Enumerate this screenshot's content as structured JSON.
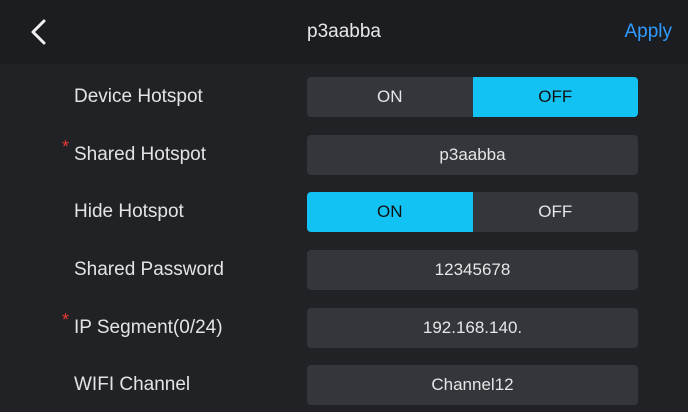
{
  "header": {
    "back_icon": "chevron-left-icon",
    "title": "p3aabba",
    "apply_label": "Apply",
    "apply_color": "#2f9bff"
  },
  "rows": {
    "device_hotspot": {
      "label": "Device Hotspot",
      "on_label": "ON",
      "off_label": "OFF",
      "selected": "OFF"
    },
    "shared_hotspot": {
      "label": "Shared Hotspot",
      "required_mark": "*",
      "value": "p3aabba"
    },
    "hide_hotspot": {
      "label": "Hide Hotspot",
      "on_label": "ON",
      "off_label": "OFF",
      "selected": "ON"
    },
    "shared_password": {
      "label": "Shared Password",
      "value": "12345678"
    },
    "ip_segment": {
      "label": "IP Segment(0/24)",
      "required_mark": "*",
      "value": "192.168.140."
    },
    "wifi_channel": {
      "label": "WIFI Channel",
      "value": "Channel12"
    }
  },
  "colors": {
    "accent": "#12c2f3",
    "required": "#e53935"
  }
}
